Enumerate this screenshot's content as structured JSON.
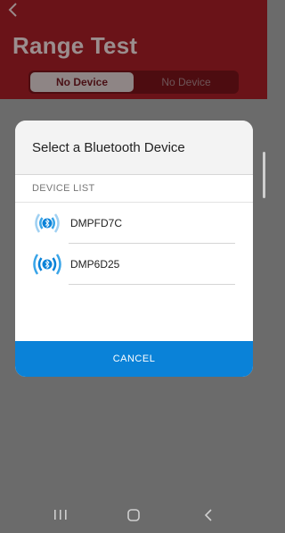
{
  "header": {
    "back_icon": "chevron-left-icon",
    "title": "Range Test",
    "segments": [
      {
        "label": "No Device"
      },
      {
        "label": "No Device"
      }
    ]
  },
  "dialog": {
    "title": "Select a Bluetooth Device",
    "list_header": "DEVICE LIST",
    "devices": [
      {
        "name": "DMPFD7C",
        "icon": "bluetooth-signal-icon"
      },
      {
        "name": "DMP6D25",
        "icon": "bluetooth-signal-icon"
      }
    ],
    "cancel_label": "CANCEL"
  },
  "navbar": {
    "recents_icon": "recents-icon",
    "home_icon": "home-icon",
    "back_icon": "back-icon"
  },
  "colors": {
    "header_bg": "#6a1318",
    "accent": "#0a82d8",
    "overlay": "#6b6b6b"
  }
}
